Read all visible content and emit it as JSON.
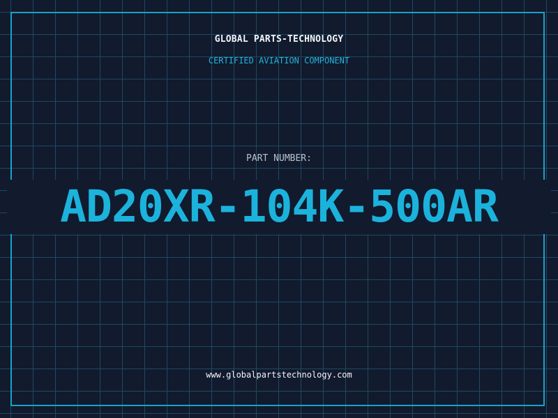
{
  "header": {
    "company": "GLOBAL PARTS-TECHNOLOGY",
    "tagline": "CERTIFIED AVIATION COMPONENT"
  },
  "part": {
    "label": "PART NUMBER:",
    "number": "AD20XR-104K-500AR"
  },
  "footer": {
    "website": "www.globalpartstechnology.com"
  },
  "colors": {
    "background": "#121a2e",
    "grid": "#1d4a60",
    "accent": "#1bb3dc",
    "text": "#f2f5f8"
  }
}
